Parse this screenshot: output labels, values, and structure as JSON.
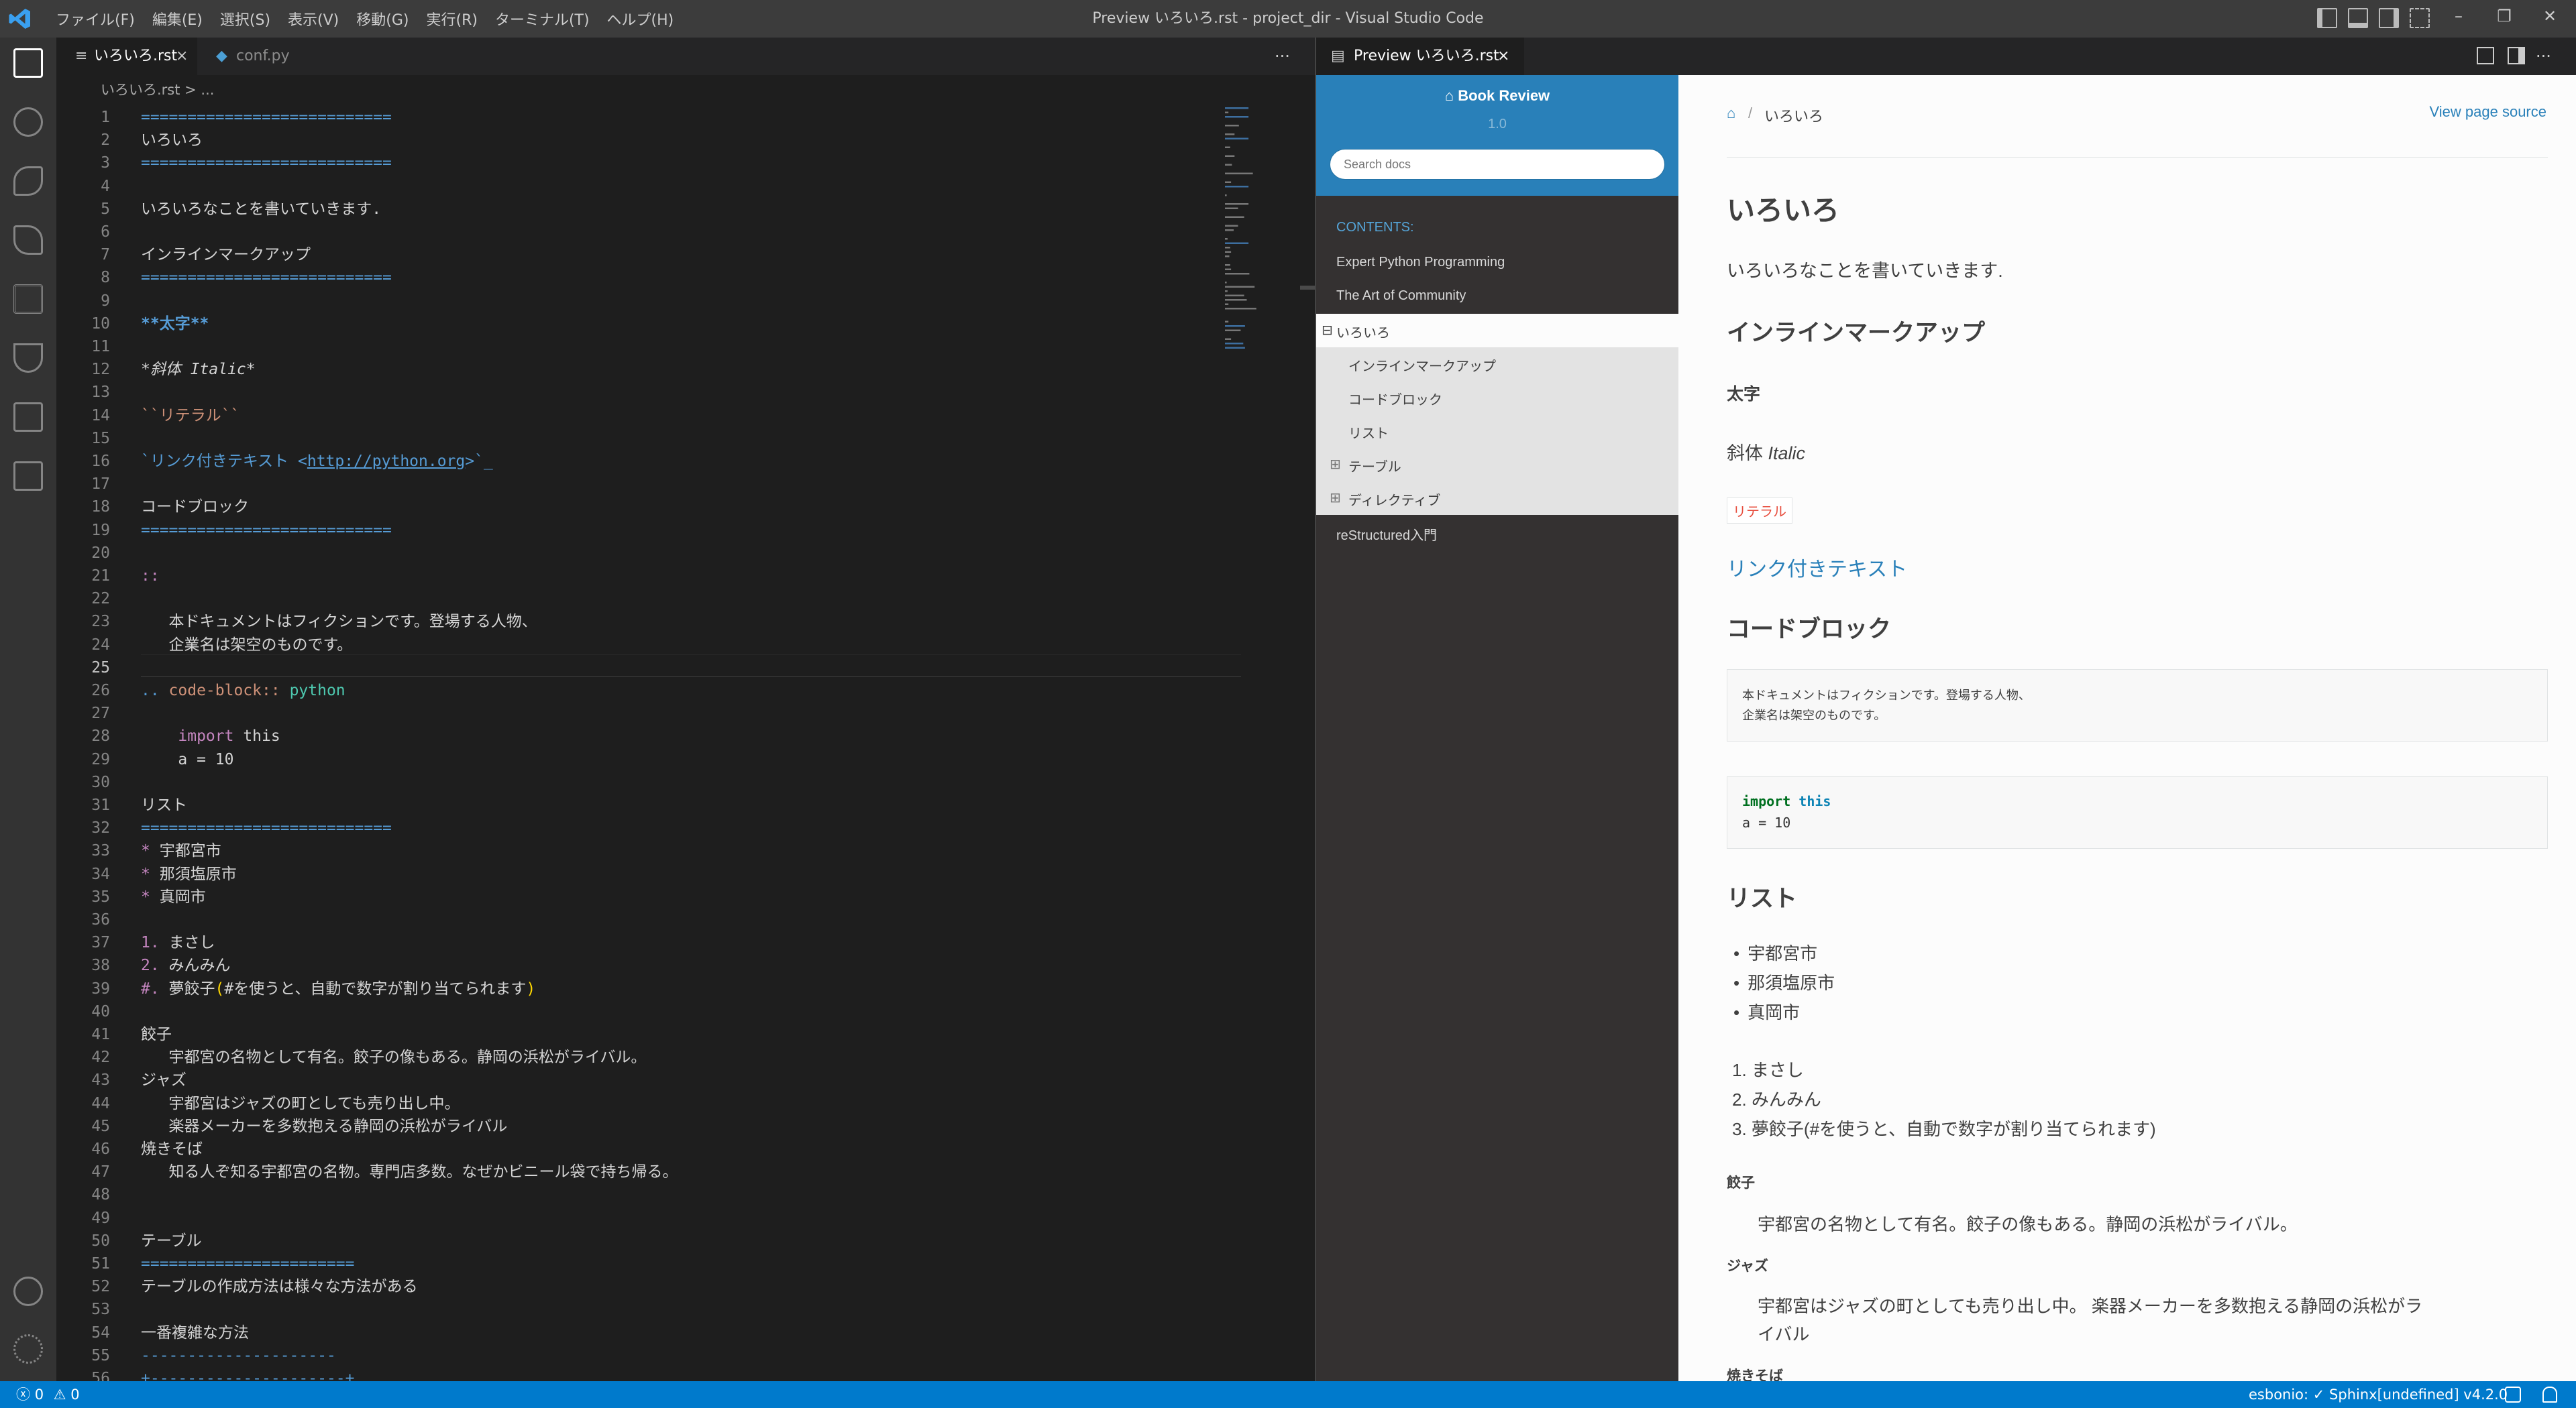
{
  "titlebar": {
    "window_title": "Preview いろいろ.rst - project_dir - Visual Studio Code",
    "menu": [
      "ファイル(F)",
      "編集(E)",
      "選択(S)",
      "表示(V)",
      "移動(G)",
      "実行(R)",
      "ターミナル(T)",
      "ヘルプ(H)"
    ]
  },
  "left_group": {
    "tabs": [
      {
        "label": "いろいろ.rst",
        "close": "×"
      },
      {
        "label": "conf.py"
      }
    ],
    "more": "···",
    "breadcrumb": "いろいろ.rst > ...",
    "lines": [
      {
        "n": "1",
        "text": "==========================="
      },
      {
        "n": "2",
        "text": "いろいろ"
      },
      {
        "n": "3",
        "text": "==========================="
      },
      {
        "n": "4",
        "text": ""
      },
      {
        "n": "5",
        "text": "いろいろなことを書いていきます."
      },
      {
        "n": "6",
        "text": ""
      },
      {
        "n": "7",
        "text": "インラインマークアップ"
      },
      {
        "n": "8",
        "text": "==========================="
      },
      {
        "n": "9",
        "text": ""
      },
      {
        "n": "10",
        "text": "**太字**"
      },
      {
        "n": "11",
        "text": ""
      },
      {
        "n": "12",
        "text": "*斜体 Italic*"
      },
      {
        "n": "13",
        "text": ""
      },
      {
        "n": "14",
        "text": "``リテラル``"
      },
      {
        "n": "15",
        "text": ""
      },
      {
        "n": "16",
        "text": "`リンク付きテキスト <http://python.org>`_"
      },
      {
        "n": "17",
        "text": ""
      },
      {
        "n": "18",
        "text": "コードブロック"
      },
      {
        "n": "19",
        "text": "==========================="
      },
      {
        "n": "20",
        "text": ""
      },
      {
        "n": "21",
        "text": "::"
      },
      {
        "n": "22",
        "text": ""
      },
      {
        "n": "23",
        "text": "   本ドキュメントはフィクションです。登場する人物、"
      },
      {
        "n": "24",
        "text": "   企業名は架空のものです。"
      },
      {
        "n": "25",
        "text": ""
      },
      {
        "n": "26",
        "text": ".. code-block:: python"
      },
      {
        "n": "27",
        "text": ""
      },
      {
        "n": "28",
        "text": "    import this"
      },
      {
        "n": "29",
        "text": "    a = 10"
      },
      {
        "n": "30",
        "text": ""
      },
      {
        "n": "31",
        "text": "リスト"
      },
      {
        "n": "32",
        "text": "==========================="
      },
      {
        "n": "33",
        "text": "* 宇都宮市"
      },
      {
        "n": "34",
        "text": "* 那須塩原市"
      },
      {
        "n": "35",
        "text": "* 真岡市"
      },
      {
        "n": "36",
        "text": ""
      },
      {
        "n": "37",
        "text": "1. まさし"
      },
      {
        "n": "38",
        "text": "2. みんみん"
      },
      {
        "n": "39",
        "text": "#. 夢餃子(#を使うと、自動で数字が割り当てられます)"
      },
      {
        "n": "40",
        "text": ""
      },
      {
        "n": "41",
        "text": "餃子"
      },
      {
        "n": "42",
        "text": "   宇都宮の名物として有名。餃子の像もある。静岡の浜松がライバル。"
      },
      {
        "n": "43",
        "text": "ジャズ"
      },
      {
        "n": "44",
        "text": "   宇都宮はジャズの町としても売り出し中。"
      },
      {
        "n": "45",
        "text": "   楽器メーカーを多数抱える静岡の浜松がライバル"
      },
      {
        "n": "46",
        "text": "焼きそば"
      },
      {
        "n": "47",
        "text": "   知る人ぞ知る宇都宮の名物。専門店多数。なぜかビニール袋で持ち帰る。"
      },
      {
        "n": "48",
        "text": ""
      },
      {
        "n": "49",
        "text": ""
      },
      {
        "n": "50",
        "text": "テーブル"
      },
      {
        "n": "51",
        "text": "======================="
      },
      {
        "n": "52",
        "text": "テーブルの作成方法は様々な方法がある"
      },
      {
        "n": "53",
        "text": ""
      },
      {
        "n": "54",
        "text": "一番複雑な方法"
      },
      {
        "n": "55",
        "text": "---------------------"
      },
      {
        "n": "56",
        "text": "+---------------------+"
      }
    ]
  },
  "right_group": {
    "tab_label": "Preview いろいろ.rst",
    "tab_close": "×",
    "more": "···",
    "nav": {
      "project": "Book Review",
      "version": "1.0",
      "search_placeholder": "Search docs",
      "caption": "CONTENTS:",
      "items": [
        "Expert Python Programming",
        "The Art of Community",
        "いろいろ",
        "reStructured入門"
      ],
      "current": "いろいろ",
      "subitems": [
        "インラインマークアップ",
        "コードブロック",
        "リスト",
        "テーブル",
        "ディレクティブ"
      ],
      "expander": "⊟",
      "sub_expander": "⊞"
    },
    "content": {
      "breadcrumb_sep": "/",
      "breadcrumb_current": "いろいろ",
      "view_source": "View page source",
      "h1": "いろいろ",
      "intro": "いろいろなことを書いていきます.",
      "h2_inline": "インラインマークアップ",
      "bold": "太字",
      "italic_jp": "斜体",
      "italic_en": "Italic",
      "literal": "リテラル",
      "link": "リンク付きテキスト",
      "h2_code": "コードブロック",
      "literal_block": [
        "本ドキュメントはフィクションです。登場する人物、",
        "企業名は架空のものです。"
      ],
      "code_kw1": "import",
      "code_kw2": "this",
      "code_line2": "a = 10",
      "h2_list": "リスト",
      "bullets": [
        "宇都宮市",
        "那須塩原市",
        "真岡市"
      ],
      "ordered": [
        {
          "n": "1.",
          "t": "まさし"
        },
        {
          "n": "2.",
          "t": "みんみん"
        },
        {
          "n": "3.",
          "t": "夢餃子(#を使うと、自動で数字が割り当てられます)"
        }
      ],
      "dl": [
        {
          "term": "餃子",
          "def": "宇都宮の名物として有名。餃子の像もある。静岡の浜松がライバル。"
        },
        {
          "term": "ジャズ",
          "def": "宇都宮はジャズの町としても売り出し中。 楽器メーカーを多数抱える静岡の浜松がラ",
          "def2": "イバル"
        },
        {
          "term": "焼きそば"
        }
      ]
    }
  },
  "statusbar": {
    "errors": "0",
    "warnings": "0",
    "esbonio": "esbonio: ✓ Sphinx[undefined] v4.2.0"
  },
  "colors": {
    "accent": "#007acc",
    "rtd_blue": "#2980b9",
    "rst_header": "#569cd6",
    "rst_bold": "#569cd6",
    "rst_literal": "#ce9178",
    "rst_list_marker": "#c586c0"
  }
}
